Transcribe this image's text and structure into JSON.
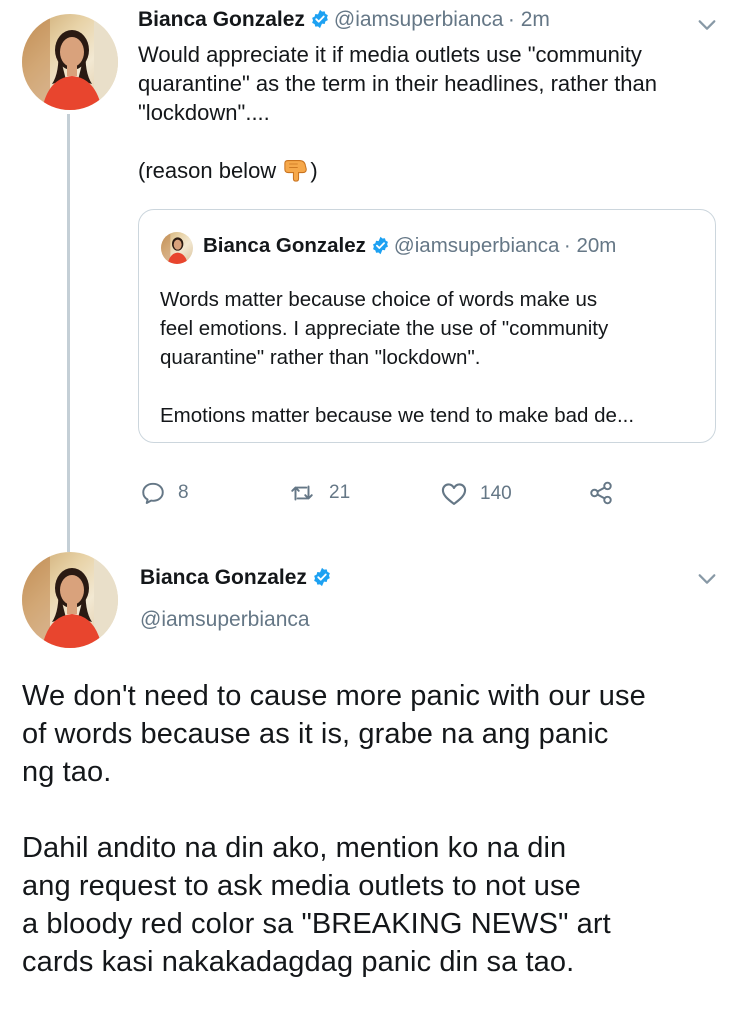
{
  "tweet1": {
    "name": "Bianca Gonzalez",
    "handle": "@iamsuperbianca",
    "sep_time": "· 2m",
    "text_lines": [
      "Would appreciate it if media outlets use \"community",
      "quarantine\" as the term in their headlines, rather than",
      "\"lockdown\"...."
    ],
    "reason_text": "(reason below ",
    "reason_close": ")",
    "quote": {
      "name": "Bianca Gonzalez",
      "handle": "@iamsuperbianca",
      "sep_time": "· 20m",
      "lines": [
        "Words matter because choice of words make us",
        "feel emotions. I appreciate the use of \"community",
        "quarantine\" rather than \"lockdown\"."
      ],
      "line4": "Emotions matter because we tend to make bad de..."
    },
    "actions": {
      "replies": "8",
      "retweets": "21",
      "likes": "140"
    }
  },
  "tweet2": {
    "name": "Bianca Gonzalez",
    "handle": "@iamsuperbianca",
    "para1": [
      "We don't need to cause more panic with our use",
      "of words because as it is, grabe na ang panic",
      "ng tao."
    ],
    "para2": [
      "Dahil andito na din ako, mention ko na din",
      "ang request to ask media outlets to not use",
      "a bloody red color sa \"BREAKING NEWS\" art",
      "cards kasi nakakadagdag panic din sa tao."
    ]
  },
  "colors": {
    "verified": "#1da1f2",
    "muted": "#657786",
    "text": "#14171a",
    "border": "#ccd6dd",
    "thread_line": "#c4cfd6"
  }
}
